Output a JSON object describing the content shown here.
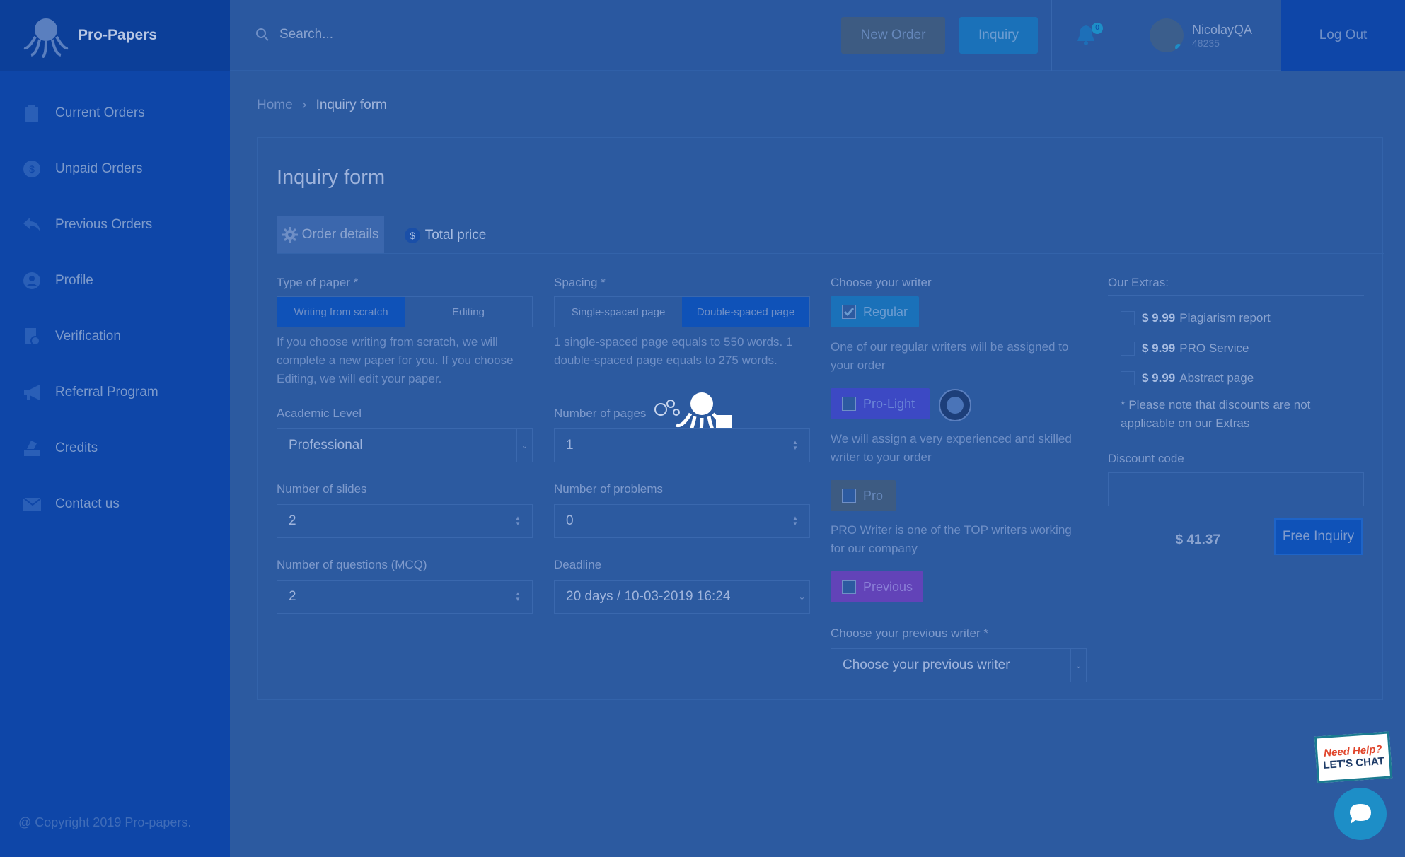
{
  "app": {
    "brand": "Pro-Papers"
  },
  "sidebar": {
    "items": [
      {
        "label": "Current Orders",
        "icon": "clipboard-icon"
      },
      {
        "label": "Unpaid Orders",
        "icon": "dollar-icon"
      },
      {
        "label": "Previous Orders",
        "icon": "reply-icon"
      },
      {
        "label": "Profile",
        "icon": "user-icon"
      },
      {
        "label": "Verification",
        "icon": "verification-icon"
      },
      {
        "label": "Referral Program",
        "icon": "megaphone-icon"
      },
      {
        "label": "Credits",
        "icon": "credits-icon"
      },
      {
        "label": "Contact us",
        "icon": "envelope-icon"
      }
    ],
    "copyright": "@ Copyright 2019 Pro-papers."
  },
  "header": {
    "search_placeholder": "Search...",
    "new_order": "New Order",
    "inquiry": "Inquiry",
    "notifications_count": "0",
    "user_name": "NicolayQA",
    "user_id": "48235",
    "logout": "Log Out"
  },
  "breadcrumb": {
    "home": "Home",
    "sep": "›",
    "current": "Inquiry form"
  },
  "form": {
    "title": "Inquiry form",
    "tabs": {
      "order_details": "Order details",
      "total_price": "Total price"
    },
    "type_of_paper": {
      "label": "Type of paper *",
      "options": [
        "Writing from scratch",
        "Editing"
      ],
      "selected": "Writing from scratch",
      "help": "If you choose writing from scratch, we will complete a new paper for you. If you choose Editing, we will edit your paper."
    },
    "spacing": {
      "label": "Spacing *",
      "options": [
        "Single-spaced page",
        "Double-spaced page"
      ],
      "selected": "Double-spaced page",
      "help": "1 single-spaced page equals to 550 words. 1 double-spaced page equals to 275 words."
    },
    "academic_level": {
      "label": "Academic Level",
      "value": "Professional"
    },
    "number_of_pages": {
      "label": "Number of pages",
      "value": "1"
    },
    "number_of_slides": {
      "label": "Number of slides",
      "value": "2"
    },
    "number_of_problems": {
      "label": "Number of problems",
      "value": "0"
    },
    "number_of_questions": {
      "label": "Number of questions (MCQ)",
      "value": "2"
    },
    "deadline": {
      "label": "Deadline",
      "value": "20 days / 10-03-2019 16:24"
    },
    "writer": {
      "label": "Choose your writer",
      "regular": {
        "label": "Regular",
        "checked": true,
        "help": "One of our regular writers will be assigned to your order"
      },
      "pro_light": {
        "label": "Pro-Light",
        "checked": false,
        "help": "We will assign a very experienced and skilled writer to your order"
      },
      "pro": {
        "label": "Pro",
        "checked": false,
        "help": "PRO Writer is one of the TOP writers working for our company"
      },
      "previous": {
        "label": "Previous",
        "checked": false
      },
      "previous_writer_label": "Choose your previous writer *",
      "previous_writer_value": "Choose your previous writer"
    },
    "extras": {
      "label": "Our Extras:",
      "items": [
        {
          "price": "$ 9.99",
          "name": "Plagiarism report"
        },
        {
          "price": "$ 9.99",
          "name": "PRO Service"
        },
        {
          "price": "$ 9.99",
          "name": "Abstract page"
        }
      ],
      "note": "* Please note that discounts are not applicable on our Extras"
    },
    "discount": {
      "label": "Discount code",
      "value": ""
    },
    "total": "$ 41.37",
    "submit": "Free Inquiry"
  },
  "chat": {
    "line1": "Need Help?",
    "line2": "LET'S CHAT"
  },
  "colors": {
    "sidebar": "#0e46a8",
    "overlay": "#2c5aa0",
    "accent": "#1a71b9"
  }
}
